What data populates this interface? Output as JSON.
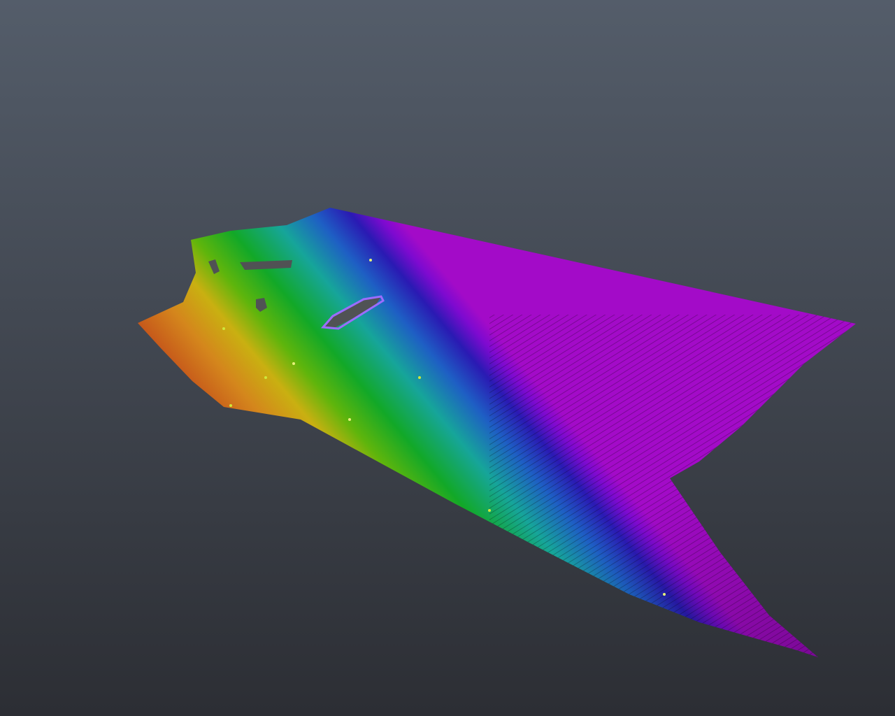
{
  "viewport": {
    "background_top": "#545d6a",
    "background_bottom": "#2c2e34"
  },
  "point_cloud": {
    "colormap": "elevation-rainbow",
    "palette": [
      "#c0441a",
      "#d4861c",
      "#c9b011",
      "#5fb50c",
      "#12a828",
      "#16a59a",
      "#1e5fc4",
      "#2a1ab3",
      "#7d0ad0",
      "#a30bc8"
    ],
    "data_gap_color": "#505254",
    "data_gap_count": 4
  }
}
